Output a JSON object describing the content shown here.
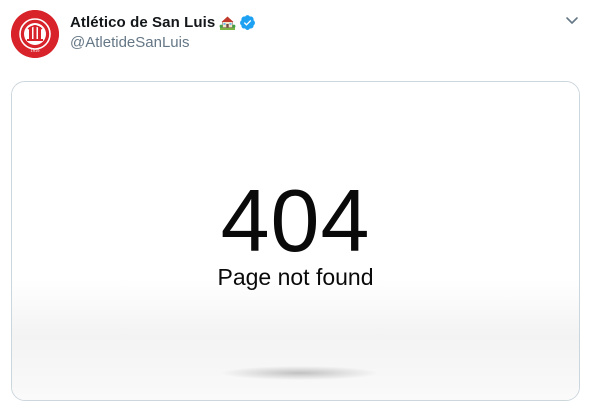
{
  "tweet": {
    "display_name": "Atlético de San Luis",
    "handle": "@AtletideSanLuis",
    "icons": {
      "house": "house-with-garden-emoji-icon",
      "verified": "verified-badge-icon",
      "caret": "chevron-down-icon",
      "avatar": "club-crest-logo"
    },
    "colors": {
      "verified": "#1da1f2",
      "avatar_bg": "#d8232a",
      "name": "#14171a",
      "handle": "#657786",
      "card_border": "#ccd6dd"
    }
  },
  "media": {
    "error_code": "404",
    "error_message": "Page not found"
  }
}
